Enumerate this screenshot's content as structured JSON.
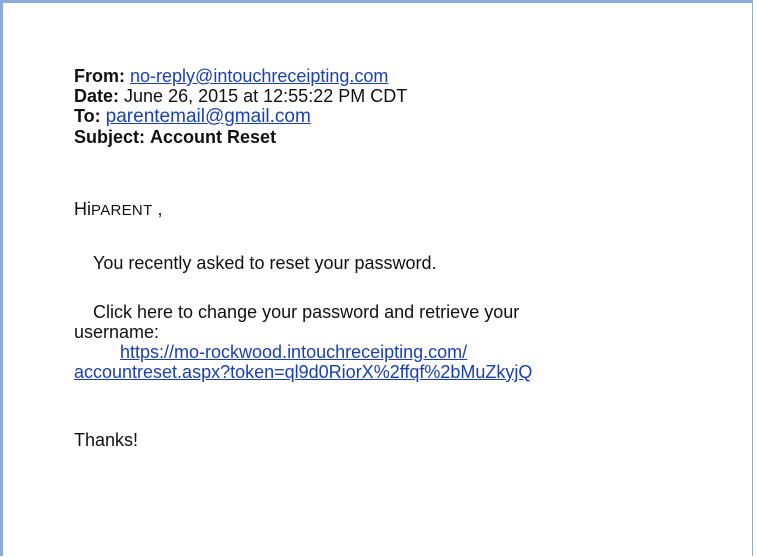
{
  "email": {
    "from_label": "From:",
    "from_value": "no-reply@intouchreceipting.com",
    "date_label": "Date:",
    "date_value": "June 26, 2015 at 12:55:22 PM CDT",
    "to_label": "To:",
    "to_value": "parentemail@gmail.com",
    "subject_label": "Subject:",
    "subject_value": "Account Reset"
  },
  "body": {
    "greeting_hi": "Hi",
    "greeting_name": "PARENT",
    "greeting_comma": ",",
    "paragraph1": "You recently asked to reset your password.",
    "paragraph2_line1": "Click here to change your password and retrieve your",
    "paragraph2_line2": "username:",
    "reset_link_line1": "https://mo-rockwood.intouchreceipting.com/",
    "reset_link_line2": "accountreset.aspx?token=ql9d0RiorX%2ffqf%2bMuZkyjQ",
    "closing": "Thanks!"
  },
  "colors": {
    "border": "#8eaadb",
    "link": "#1a3fb5"
  }
}
